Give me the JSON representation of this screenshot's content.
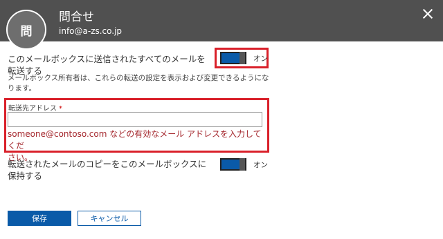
{
  "header": {
    "avatar_text": "問",
    "title": "問合せ",
    "email": "info@a-zs.co.jp"
  },
  "forwarding": {
    "label_line1": "このメールボックスに送信されたすべてのメールを",
    "label_line2": "転送する",
    "description_line1": "メールボックス所有者は、これらの転送の設定を表示および変更できるようにな",
    "description_line2": "ります。",
    "toggle_state": "オン"
  },
  "forward_address": {
    "label": "転送先アドレス",
    "required_mark": "*",
    "value": "",
    "error_line1": "someone@contoso.com などの有効なメール アドレスを入力してくだ",
    "error_line2": "さい。"
  },
  "keep_copy": {
    "label_line1": "転送されたメールのコピーをこのメールボックスに",
    "label_line2": "保持する",
    "toggle_state": "オン"
  },
  "buttons": {
    "save": "保存",
    "cancel": "キャンセル"
  },
  "colors": {
    "header_bg": "#505050",
    "accent": "#0a5aa8",
    "highlight": "#d9202a",
    "error": "#a4262c"
  }
}
